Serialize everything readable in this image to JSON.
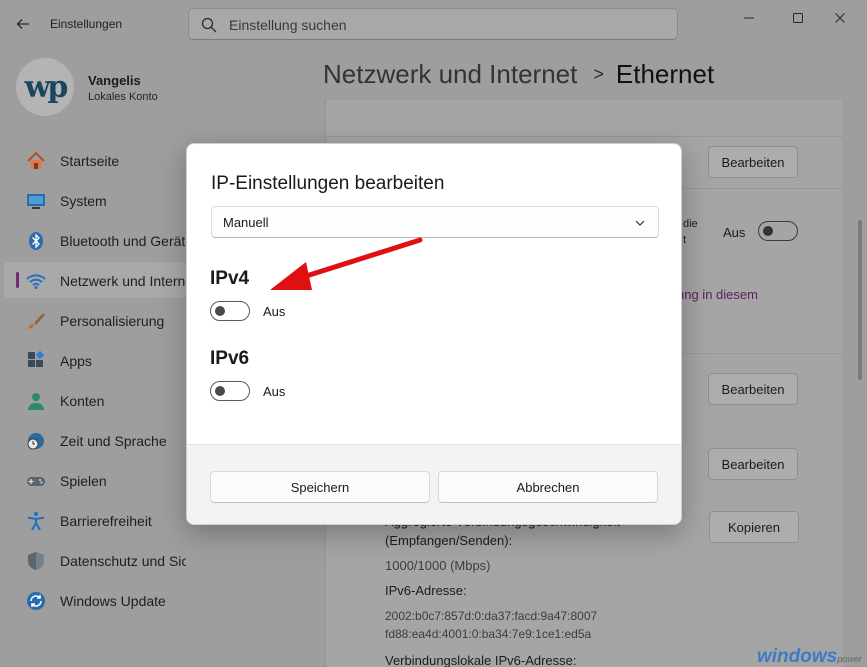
{
  "window": {
    "title": "Einstellungen",
    "search_placeholder": "Einstellung suchen"
  },
  "profile": {
    "avatar_text": "wp",
    "name": "Vangelis",
    "account_type": "Lokales Konto"
  },
  "sidebar": {
    "items": [
      {
        "label": "Startseite",
        "icon": "home-icon",
        "active": false
      },
      {
        "label": "System",
        "icon": "monitor-icon",
        "active": false
      },
      {
        "label": "Bluetooth und Geräte",
        "icon": "bluetooth-icon",
        "active": false
      },
      {
        "label": "Netzwerk und Internet",
        "icon": "wifi-icon",
        "active": true
      },
      {
        "label": "Personalisierung",
        "icon": "brush-icon",
        "active": false
      },
      {
        "label": "Apps",
        "icon": "apps-icon",
        "active": false
      },
      {
        "label": "Konten",
        "icon": "person-icon",
        "active": false
      },
      {
        "label": "Zeit und Sprache",
        "icon": "clock-globe-icon",
        "active": false
      },
      {
        "label": "Spielen",
        "icon": "gamepad-icon",
        "active": false
      },
      {
        "label": "Barrierefreiheit",
        "icon": "accessibility-icon",
        "active": false
      },
      {
        "label": "Datenschutz und Sicherheit",
        "icon": "shield-icon",
        "active": false
      },
      {
        "label": "Windows Update",
        "icon": "update-icon",
        "active": false
      }
    ]
  },
  "header": {
    "parent": "Netzwerk und Internet",
    "separator": ">",
    "current": "Ethernet"
  },
  "background": {
    "edit_label": "Bearbeiten",
    "partial_text_1": "die",
    "partial_text_2": "t",
    "toggle_label": "Aus",
    "partial_link": "ung in diesem",
    "copy_label": "Kopieren",
    "speed_label_line0": "Aggregierte Verbindungsgeschwindigkeit",
    "speed_label_line1": "(Empfangen/Senden):",
    "speed_value": "1000/1000 (Mbps)",
    "ipv6_label": "IPv6-Adresse:",
    "ipv6_value_1": "2002:b0c7:857d:0:da37:facd:9a47:8007",
    "ipv6_value_2": "fd88:ea4d:4001:0:ba34:7e9:1ce1:ed5a",
    "linklocal_label": "Verbindungslokale IPv6-Adresse:"
  },
  "dialog": {
    "title": "IP-Einstellungen bearbeiten",
    "mode_value": "Manuell",
    "ipv4": {
      "heading": "IPv4",
      "state": "Aus"
    },
    "ipv6": {
      "heading": "IPv6",
      "state": "Aus"
    },
    "save_label": "Speichern",
    "cancel_label": "Abbrechen"
  },
  "watermark": {
    "brand": "windows",
    "suffix": "power"
  },
  "colors": {
    "accent": "#6d2b73",
    "annotation_arrow": "#e01010",
    "watermark": "#3d7bc5"
  }
}
